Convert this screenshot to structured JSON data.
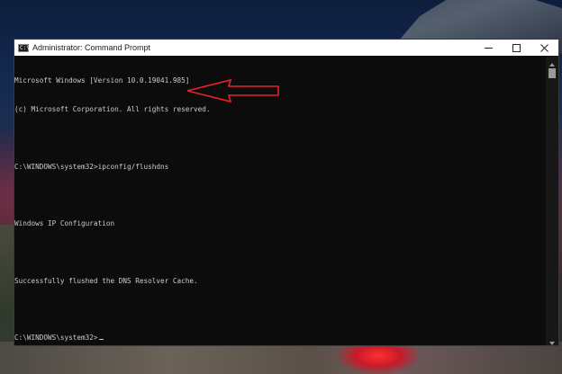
{
  "window": {
    "title": "Administrator: Command Prompt",
    "icon": "cmd-app-icon",
    "icon_glyph": "C:\\"
  },
  "controls": {
    "minimize_icon": "minimize-icon",
    "maximize_icon": "maximize-icon",
    "close_icon": "close-icon"
  },
  "console": {
    "lines": [
      "Microsoft Windows [Version 10.0.19041.985]",
      "(c) Microsoft Corporation. All rights reserved.",
      "",
      "C:\\WINDOWS\\system32>ipconfig/flushdns",
      "",
      "Windows IP Configuration",
      "",
      "Successfully flushed the DNS Resolver Cache.",
      "",
      "C:\\WINDOWS\\system32>"
    ]
  },
  "annotation": {
    "arrow_color": "#e8202a",
    "arrow_icon": "red-arrow-icon"
  },
  "colors": {
    "console_bg": "#0c0c0c",
    "console_text": "#cccccc",
    "titlebar_bg": "#ffffff"
  }
}
